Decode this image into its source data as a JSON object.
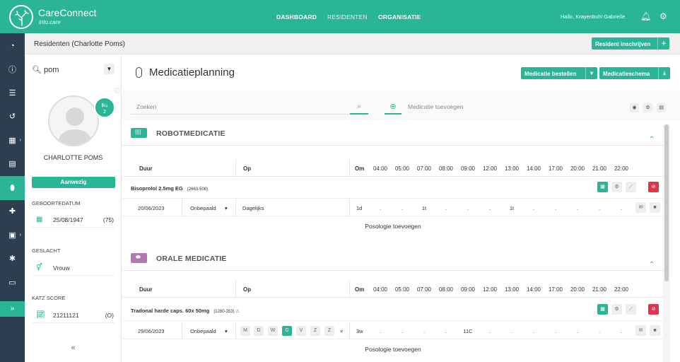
{
  "app": {
    "name": "CareConnect",
    "subtitle": "into.care"
  },
  "topnav": [
    {
      "label": "DASHBOARD",
      "active": false
    },
    {
      "label": "RESIDENTEN",
      "active": true
    },
    {
      "label": "ORGANISATIE",
      "active": false
    }
  ],
  "user": {
    "greeting": "Hallo, Krayenbuhl Gabrielle"
  },
  "sidebar": {
    "items": [
      "dashboard-icon",
      "info-icon",
      "list-icon",
      "history-icon",
      "calendar-icon",
      "document-icon",
      "medication-icon",
      "medical-kit-icon",
      "file-icon",
      "bug-icon",
      "card-icon"
    ],
    "expand_label": "»"
  },
  "breadcrumb": {
    "text": "Residenten (Charlotte Poms)",
    "button": "Resident inschrijven"
  },
  "resident": {
    "search_value": "pom",
    "bed_count": "2",
    "name": "CHARLOTTE POMS",
    "status": "Aanwezig",
    "birth_label": "GEBOORTEDATUM",
    "birth_date": "25/08/1947",
    "age": "(75)",
    "gender_label": "GESLACHT",
    "gender": "Vrouw",
    "katz_label": "KATZ SCORE",
    "katz": "21211121",
    "katz_suffix": "(O)",
    "collapse": "«"
  },
  "page": {
    "title": "Medicatieplanning",
    "btn_order": "Medicatie bestellen",
    "btn_schema": "Medicatieschema",
    "search_placeholder": "Zoeken",
    "add_placeholder": "Medicatie toevoegen"
  },
  "columns": {
    "duur": "Duur",
    "op": "Op",
    "om": "Om",
    "hours": [
      "04:00",
      "05:00",
      "07:00",
      "08:00",
      "09:00",
      "12:00",
      "13:00",
      "14:00",
      "17:00",
      "20:00",
      "21:00",
      "22:00"
    ]
  },
  "sections": [
    {
      "title": "ROBOTMEDICATIE",
      "color": "#2bb597",
      "med_name": "Bisoprolol 2.5mg EG",
      "med_code": "(2663-508)",
      "start": "20/06/2023",
      "duration": "Onbepaald",
      "op": "Dagelijks",
      "om": "1d",
      "cells": [
        ".",
        ".",
        "1t",
        ".",
        ".",
        ".",
        "1t",
        ".",
        ".",
        ".",
        ".",
        "."
      ],
      "posology": "Posologie toevoegen"
    },
    {
      "title": "ORALE MEDICATIE",
      "color": "#b07ab0",
      "med_name": "Tradonal harde caps. 60x 50mg",
      "med_code": "(1280-353)",
      "start": "29/06/2023",
      "duration": "Onbepaald",
      "days": [
        "M",
        "D",
        "W",
        "D",
        "V",
        "Z",
        "Z"
      ],
      "days_active": 3,
      "om": "3w",
      "cells": [
        ".",
        ".",
        ".",
        ".",
        "11C",
        ".",
        ".",
        ".",
        ".",
        ".",
        ".",
        "."
      ],
      "posology": "Posologie toevoegen"
    }
  ],
  "colors": {
    "accent": "#2bb597",
    "danger": "#e0344a",
    "sidebar": "#2d3e50"
  }
}
